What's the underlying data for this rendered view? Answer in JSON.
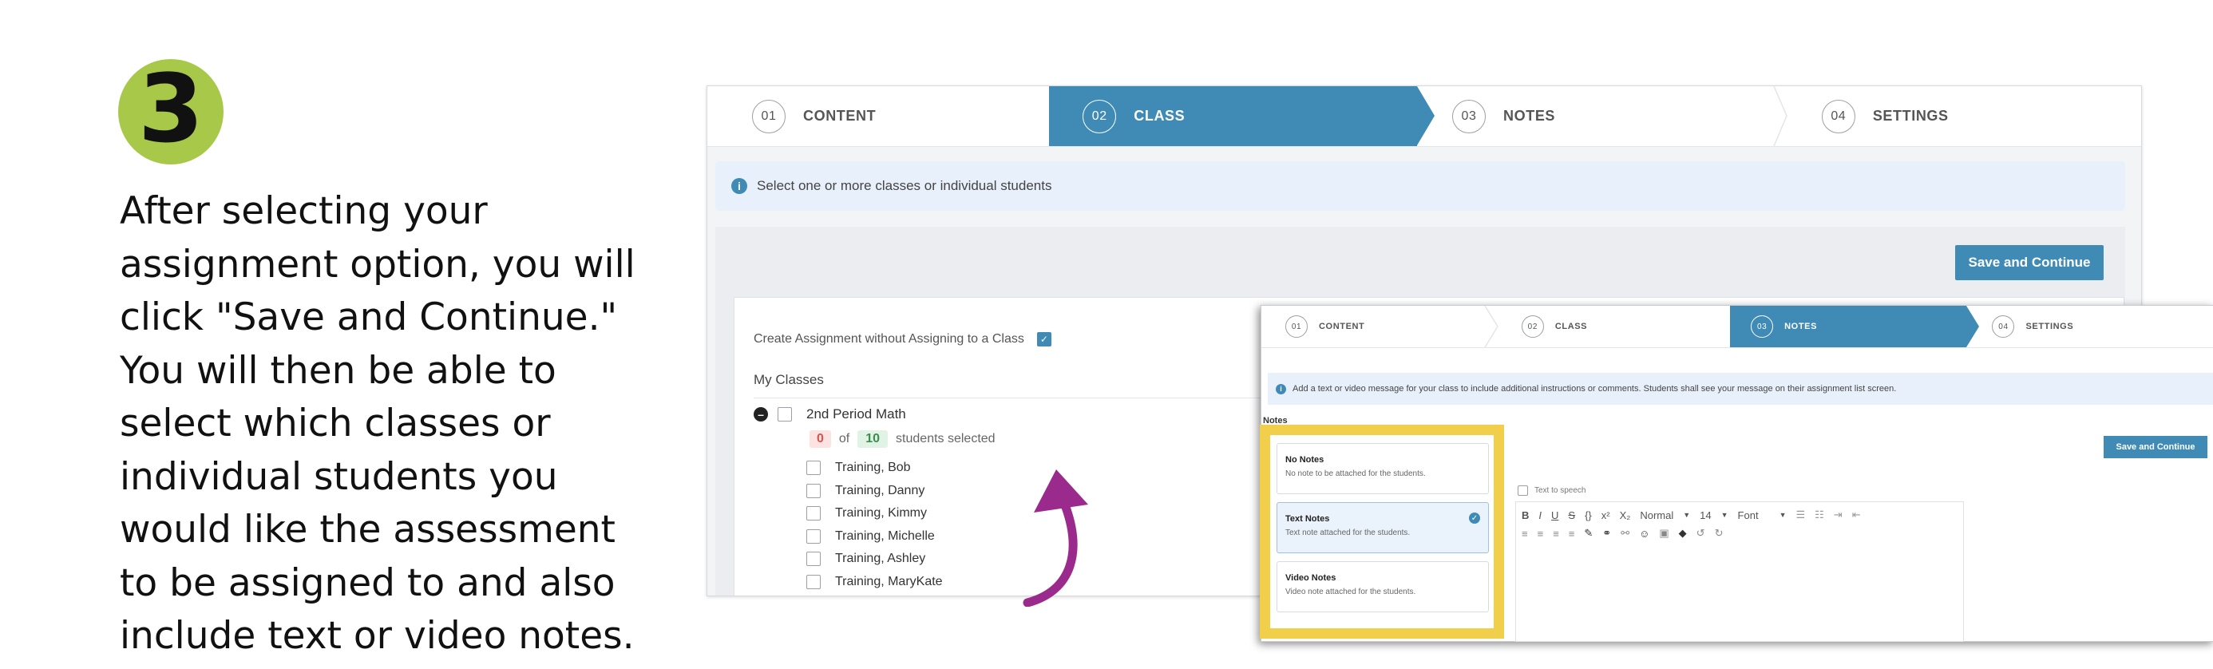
{
  "step_badge": {
    "number": "3",
    "color": "#a8c84a"
  },
  "instructions": {
    "lines": [
      "After selecting your",
      "assignment option, you will",
      "click \"Save and Continue.\"",
      "You will then be able to",
      "select which classes or",
      "individual students you",
      "would like the assessment",
      "to be assigned to and also",
      "include text or video notes."
    ]
  },
  "shot1": {
    "steps": [
      {
        "num": "01",
        "label": "CONTENT"
      },
      {
        "num": "02",
        "label": "CLASS"
      },
      {
        "num": "03",
        "label": "NOTES"
      },
      {
        "num": "04",
        "label": "SETTINGS"
      }
    ],
    "info_text": "Select one or more classes or individual students",
    "save_label": "Save and Continue",
    "create_without_class": "Create Assignment without Assigning to a Class",
    "my_classes_label": "My Classes",
    "class_name": "2nd Period Math",
    "selected_count": "0",
    "of_label": "of",
    "total_count": "10",
    "students_selected_label": "students selected",
    "students": [
      "Training, Bob",
      "Training, Danny",
      "Training, Kimmy",
      "Training, Michelle",
      "Training, Ashley",
      "Training, MaryKate"
    ]
  },
  "shot2": {
    "steps": [
      {
        "num": "01",
        "label": "CONTENT"
      },
      {
        "num": "02",
        "label": "CLASS"
      },
      {
        "num": "03",
        "label": "NOTES"
      },
      {
        "num": "04",
        "label": "SETTINGS"
      }
    ],
    "info_text": "Add a text or video message for your class to include additional instructions or comments. Students shall see your message on their assignment list screen.",
    "notes_label": "Notes",
    "save_label": "Save and Continue",
    "options": [
      {
        "title": "No Notes",
        "desc": "No note to be attached for the students."
      },
      {
        "title": "Text Notes",
        "desc": "Text note attached for the students."
      },
      {
        "title": "Video Notes",
        "desc": "Video note attached for the students."
      }
    ],
    "text_to_speech": "Text to speech",
    "toolbar": {
      "bold": "B",
      "italic": "I",
      "underline": "U",
      "strike": "S",
      "code": "{}",
      "superscript": "x²",
      "subscript": "X₂",
      "style": "Normal",
      "size": "14",
      "font": "Font"
    }
  },
  "colors": {
    "accent": "#3f8bb6",
    "highlight": "#f2cf4a",
    "arrow": "#9a2b8c",
    "badge": "#a8c84a"
  }
}
